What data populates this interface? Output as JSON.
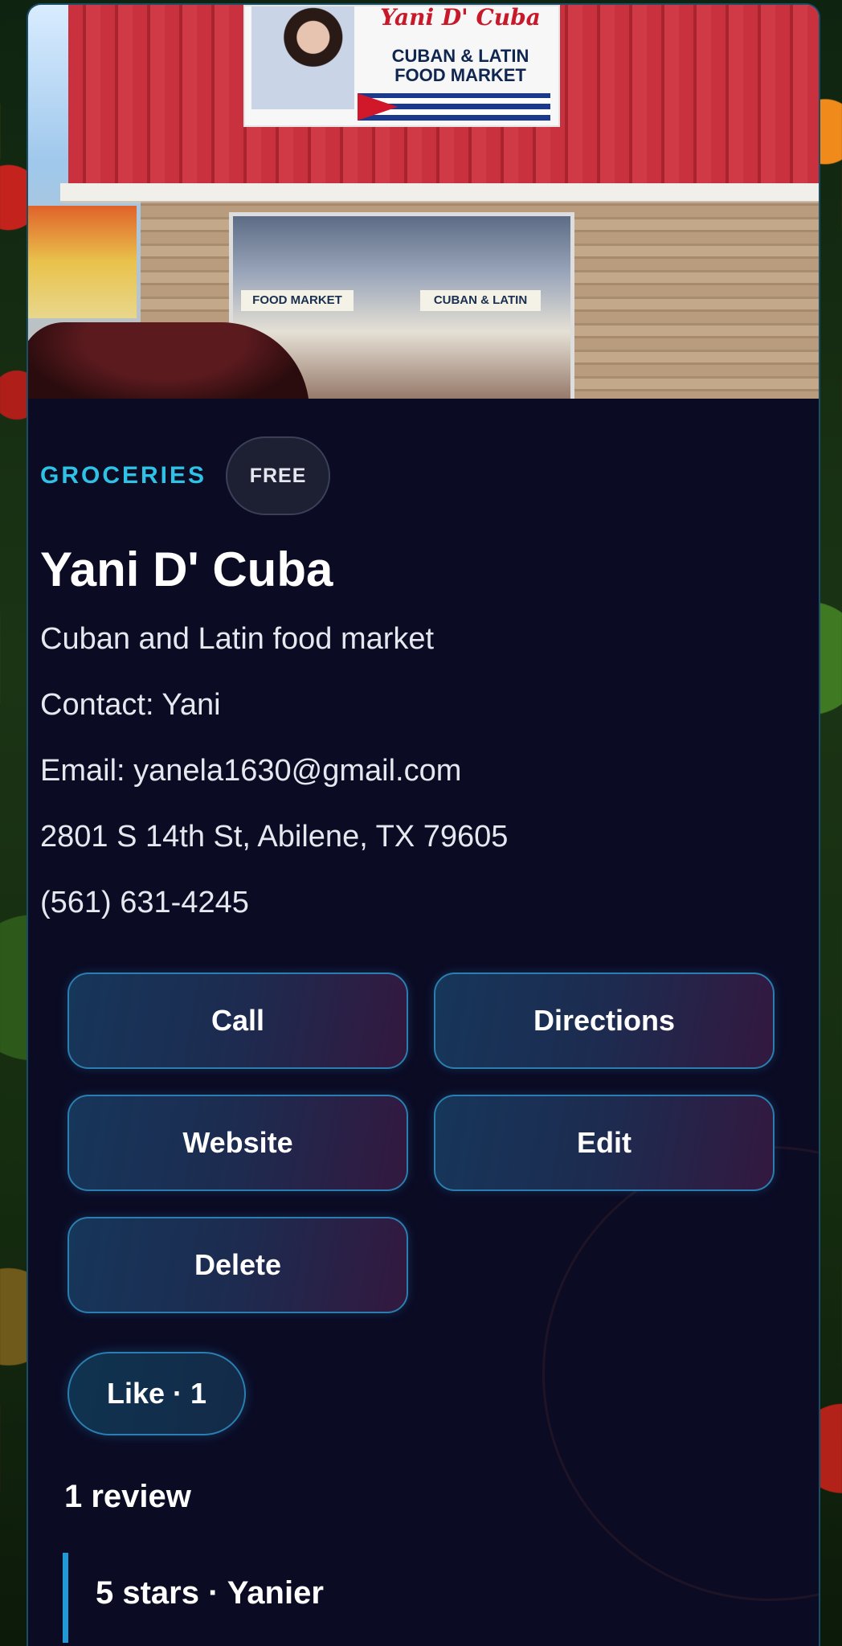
{
  "hero": {
    "banner_brand": "Yani D' Cuba",
    "banner_tagline": "CUBAN & LATIN FOOD MARKET",
    "sign_left": "FOOD MARKET",
    "sign_right": "CUBAN & LATIN"
  },
  "listing": {
    "category": "GROCERIES",
    "badge": "FREE",
    "title": "Yani D' Cuba",
    "description": "Cuban and Latin food market",
    "contact": "Contact: Yani",
    "email": "Email: yanela1630@gmail.com",
    "address": "2801 S 14th St, Abilene, TX 79605",
    "phone": "(561) 631-4245"
  },
  "actions": {
    "call": "Call",
    "directions": "Directions",
    "website": "Website",
    "edit": "Edit",
    "delete": "Delete",
    "like": "Like · 1"
  },
  "reviews": {
    "heading": "1 review",
    "items": [
      {
        "header": "5 stars · Yanier"
      }
    ]
  },
  "colors": {
    "card_background": "#0b0b24",
    "category_accent": "#2ec3e6",
    "button_border": "#2a7fb0",
    "review_accent": "#1f9ad6"
  }
}
